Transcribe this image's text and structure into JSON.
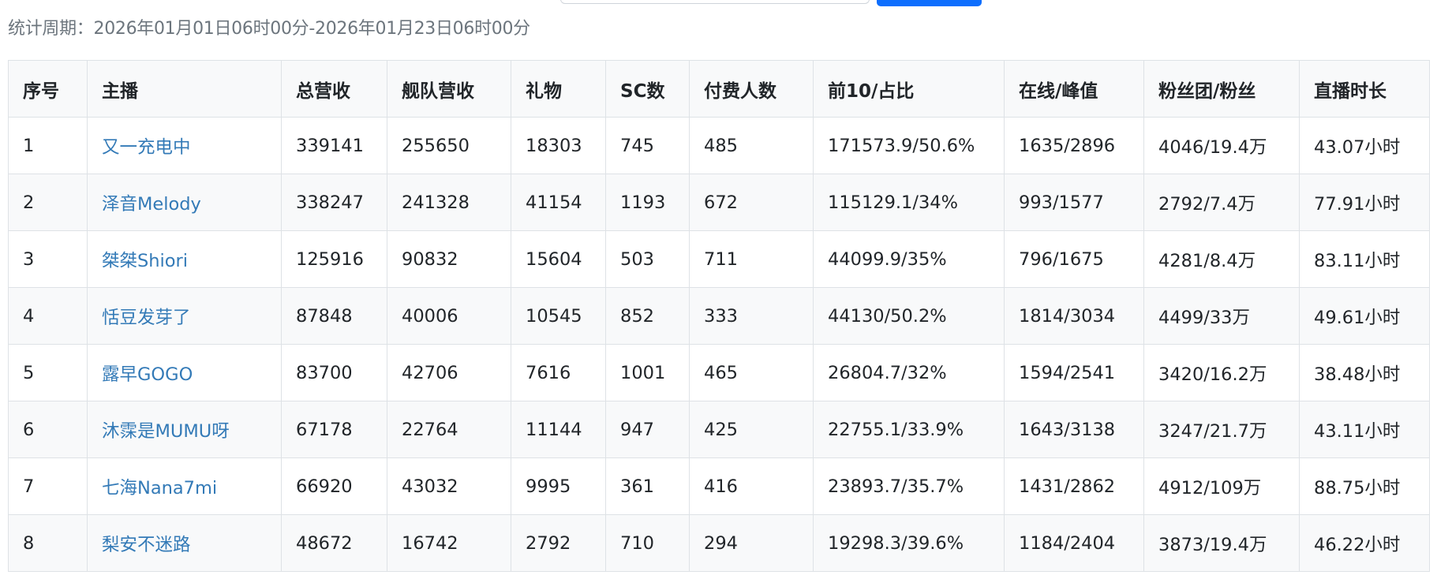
{
  "period_text": "统计周期：2026年01月01日06时00分-2026年01月23日06时00分",
  "table": {
    "headers": [
      "序号",
      "主播",
      "总营收",
      "舰队营收",
      "礼物",
      "SC数",
      "付费人数",
      "前10/占比",
      "在线/峰值",
      "粉丝团/粉丝",
      "直播时长"
    ],
    "rows": [
      [
        "1",
        "又一充电中",
        "339141",
        "255650",
        "18303",
        "745",
        "485",
        "171573.9/50.6%",
        "1635/2896",
        "4046/19.4万",
        "43.07小时"
      ],
      [
        "2",
        "泽音Melody",
        "338247",
        "241328",
        "41154",
        "1193",
        "672",
        "115129.1/34%",
        "993/1577",
        "2792/7.4万",
        "77.91小时"
      ],
      [
        "3",
        "桀桀Shiori",
        "125916",
        "90832",
        "15604",
        "503",
        "711",
        "44099.9/35%",
        "796/1675",
        "4281/8.4万",
        "83.11小时"
      ],
      [
        "4",
        "恬豆发芽了",
        "87848",
        "40006",
        "10545",
        "852",
        "333",
        "44130/50.2%",
        "1814/3034",
        "4499/33万",
        "49.61小时"
      ],
      [
        "5",
        "露早GOGO",
        "83700",
        "42706",
        "7616",
        "1001",
        "465",
        "26804.7/32%",
        "1594/2541",
        "3420/16.2万",
        "38.48小时"
      ],
      [
        "6",
        "沐霂是MUMU呀",
        "67178",
        "22764",
        "11144",
        "947",
        "425",
        "22755.1/33.9%",
        "1643/3138",
        "3247/21.7万",
        "43.11小时"
      ],
      [
        "7",
        "七海Nana7mi",
        "66920",
        "43032",
        "9995",
        "361",
        "416",
        "23893.7/35.7%",
        "1431/2862",
        "4912/109万",
        "88.75小时"
      ],
      [
        "8",
        "梨安不迷路",
        "48672",
        "16742",
        "2792",
        "710",
        "294",
        "19298.3/39.6%",
        "1184/2404",
        "3873/19.4万",
        "46.22小时"
      ]
    ]
  },
  "colors": {
    "link": "#337ab7",
    "muted": "#6c757d",
    "primary_button": "#0d6efd",
    "border": "#dee2e6",
    "stripe": "#f8f9fa"
  }
}
